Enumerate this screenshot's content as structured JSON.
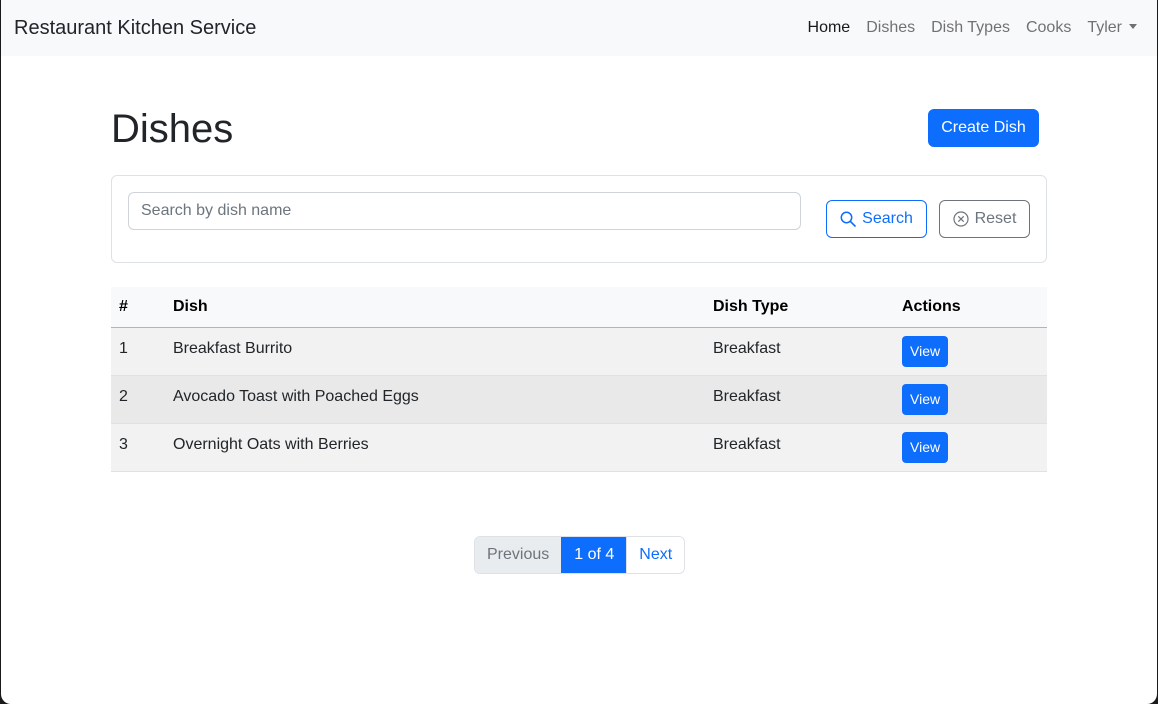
{
  "navbar": {
    "brand": "Restaurant Kitchen Service",
    "links": [
      "Home",
      "Dishes",
      "Dish Types",
      "Cooks"
    ],
    "user": "Tyler"
  },
  "page": {
    "title": "Dishes",
    "create_button": "Create Dish"
  },
  "search": {
    "placeholder": "Search by dish name",
    "value": "",
    "search_label": "Search",
    "reset_label": "Reset"
  },
  "table": {
    "headers": [
      "#",
      "Dish",
      "Dish Type",
      "Actions"
    ],
    "rows": [
      {
        "num": "1",
        "dish": "Breakfast Burrito",
        "type": "Breakfast",
        "action": "View"
      },
      {
        "num": "2",
        "dish": "Avocado Toast with Poached Eggs",
        "type": "Breakfast",
        "action": "View"
      },
      {
        "num": "3",
        "dish": "Overnight Oats with Berries",
        "type": "Breakfast",
        "action": "View"
      }
    ]
  },
  "pagination": {
    "previous": "Previous",
    "current": "1 of 4",
    "next": "Next"
  },
  "colors": {
    "primary": "#0d6efd",
    "navbar_bg": "#f8f9fa",
    "secondary": "#6c757d"
  }
}
